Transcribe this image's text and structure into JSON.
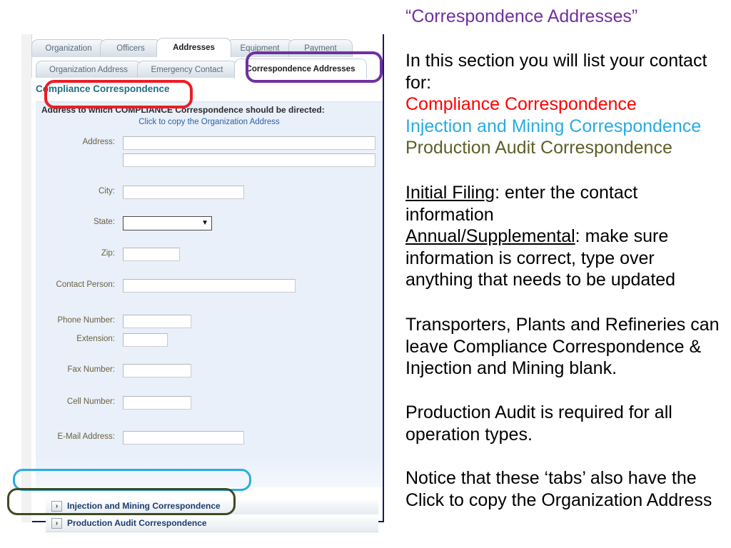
{
  "app": {
    "main_tabs": [
      {
        "label": "Organization",
        "active": false
      },
      {
        "label": "Officers",
        "active": false
      },
      {
        "label": "Addresses",
        "active": true
      },
      {
        "label": "Equipment",
        "active": false
      },
      {
        "label": "Payment",
        "active": false
      }
    ],
    "sub_tabs": [
      {
        "label": "Organization Address",
        "active": false
      },
      {
        "label": "Emergency Contact",
        "active": false
      },
      {
        "label": "Correspondence Addresses",
        "active": true
      }
    ],
    "section_title": "Compliance Correspondence",
    "directed_text": "Address to which COMPLIANCE Correspondence should be directed:",
    "copy_link": "Click to copy the Organization Address",
    "fields": [
      {
        "label": "Address:",
        "value": "",
        "type": "text"
      },
      {
        "label": "",
        "value": "",
        "type": "text"
      },
      {
        "label": "City:",
        "value": "",
        "type": "text"
      },
      {
        "label": "State:",
        "value": "",
        "type": "select"
      },
      {
        "label": "Zip:",
        "value": "",
        "type": "text"
      },
      {
        "label": "Contact Person:",
        "value": "",
        "type": "text"
      },
      {
        "label": "Phone Number:",
        "value": "",
        "type": "text"
      },
      {
        "label": "Extension:",
        "value": "",
        "type": "text"
      },
      {
        "label": "Fax Number:",
        "value": "",
        "type": "text"
      },
      {
        "label": "Cell Number:",
        "value": "",
        "type": "text"
      },
      {
        "label": "E-Mail Address:",
        "value": "",
        "type": "text"
      }
    ],
    "select_arrow_glyph": "▼",
    "expander_glyph": "›",
    "expanders": [
      {
        "label": "Injection and Mining Correspondence"
      },
      {
        "label": "Production Audit Correspondence"
      }
    ],
    "highlight_colors": {
      "compliance": "#ed1c24",
      "correspondence_addresses_tab": "#7030a0",
      "injection_mining": "#29abe2",
      "production_audit": "#3f4a22"
    }
  },
  "notes": {
    "title": "“Correspondence Addresses”",
    "intro": "In this section you will list your contact for:",
    "list": [
      {
        "text": "Compliance Correspondence",
        "color": "#ff0000"
      },
      {
        "text": "Injection and Mining Correspondence",
        "color": "#29abe2"
      },
      {
        "text": "Production Audit Correspondence",
        "color": "#5d6029"
      }
    ],
    "initial_filing_label": "Initial Filing",
    "initial_filing_text": ": enter the contact information",
    "annual_label": "Annual/Supplemental",
    "annual_text": ": make sure information is correct, type over anything that needs to be updated",
    "para_transporters": "Transporters, Plants and Refineries can leave Compliance Correspondence & Injection and Mining blank.",
    "para_production": "Production Audit is required for all operation types.",
    "para_notice": "Notice that these ‘tabs’ also have the Click to copy the Organization Address"
  }
}
